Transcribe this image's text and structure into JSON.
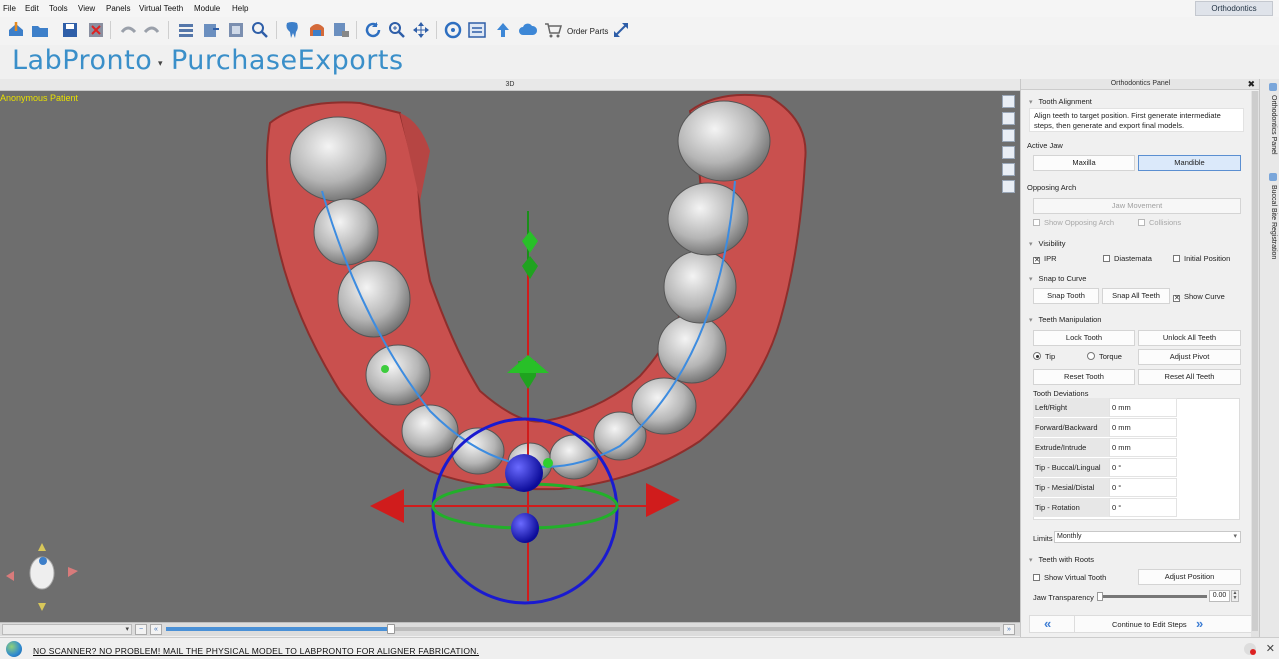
{
  "menu": [
    "File",
    "Edit",
    "Tools",
    "View",
    "Panels",
    "Virtual Teeth",
    "Module",
    "Help"
  ],
  "mode_tab": "Orthodontics",
  "toolbar": {
    "order_parts_label": "Order Parts",
    "icons": [
      "import-icon",
      "open-icon",
      "save-icon",
      "close-file-icon",
      "undo-icon",
      "redo-icon",
      "scan-list-icon",
      "export-icon",
      "library-icon",
      "find-icon",
      "tooth-icon",
      "jaw-icon",
      "lock-tooth-icon",
      "rotate-icon",
      "zoom-icon",
      "pan-icon",
      "reset-view-icon",
      "fit-icon",
      "upload-icon",
      "cloud-icon",
      "cart-icon",
      "expand-icon"
    ]
  },
  "logo": {
    "brand_left": "LabPronto",
    "brand_right": "PurchaseExports",
    "accent": "#3a8fc9"
  },
  "viewport": {
    "title": "3D",
    "patient": "Anonymous Patient"
  },
  "timeline": {
    "progress": 0.27
  },
  "statusbar": {
    "promo": "NO SCANNER? NO PROBLEM! MAIL THE PHYSICAL MODEL TO LABPRONTO FOR ALIGNER FABRICATION."
  },
  "panel": {
    "title": "Orthodontics Panel",
    "tooth_alignment": {
      "header": "Tooth Alignment",
      "description": "Align teeth to target position. First generate intermediate steps, then generate and export final models."
    },
    "active_jaw": {
      "label": "Active Jaw",
      "maxilla": "Maxilla",
      "mandible": "Mandible",
      "selected": "Mandible"
    },
    "opposing_arch": {
      "label": "Opposing Arch",
      "jaw_movement": "Jaw Movement",
      "show_opposing": "Show Opposing Arch",
      "collisions": "Collisions"
    },
    "visibility": {
      "header": "Visibility",
      "ipr": "IPR",
      "diastemata": "Diastemata",
      "initial_position": "Initial Position"
    },
    "snap": {
      "header": "Snap to Curve",
      "snap_tooth": "Snap Tooth",
      "snap_all": "Snap All Teeth",
      "show_curve": "Show Curve"
    },
    "manip": {
      "header": "Teeth Manipulation",
      "lock_tooth": "Lock Tooth",
      "unlock_all": "Unlock All Teeth",
      "tip": "Tip",
      "torque": "Torque",
      "adjust_pivot": "Adjust Pivot",
      "reset_tooth": "Reset Tooth",
      "reset_all": "Reset All Teeth",
      "deviations_label": "Tooth Deviations",
      "deviations": [
        {
          "name": "Left/Right",
          "value": "0 mm"
        },
        {
          "name": "Forward/Backward",
          "value": "0 mm"
        },
        {
          "name": "Extrude/Intrude",
          "value": "0 mm"
        },
        {
          "name": "Tip - Buccal/Lingual",
          "value": "0 °"
        },
        {
          "name": "Tip - Mesial/Distal",
          "value": "0 °"
        },
        {
          "name": "Tip - Rotation",
          "value": "0 °"
        }
      ],
      "limits_label": "Limits",
      "limits_value": "Monthly"
    },
    "roots": {
      "header": "Teeth with Roots",
      "show_virtual": "Show Virtual Tooth",
      "adjust_position": "Adjust Position",
      "jaw_transparency": "Jaw Transparency",
      "transparency_value": "0.00"
    },
    "continue": "Continue to Edit Steps"
  },
  "dock_tabs": [
    "Orthodontics Panel",
    "Buccal Bite Registration"
  ],
  "colors": {
    "viewport_bg": "#6e6e6e",
    "gum": "#c9504e",
    "tooth": "#c9c9c9",
    "gizmo_red": "#d01c1c",
    "gizmo_green": "#22b02a",
    "gizmo_blue": "#1a1ad0"
  }
}
